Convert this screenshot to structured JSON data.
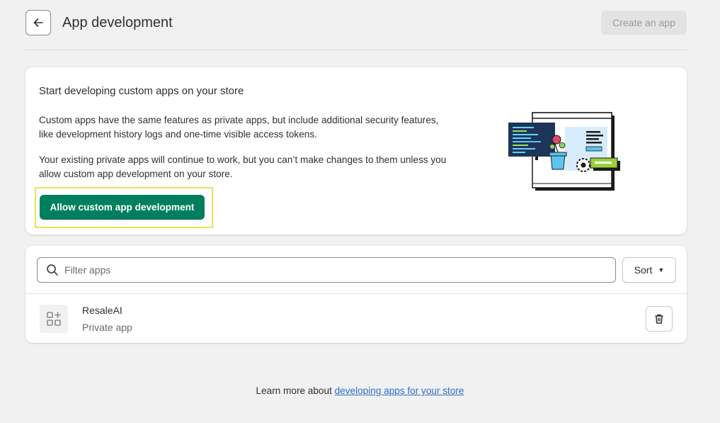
{
  "header": {
    "title": "App development",
    "create_button": "Create an app",
    "back_icon": "arrow-left-icon"
  },
  "intro": {
    "heading": "Start developing custom apps on your store",
    "paragraph1": "Custom apps have the same features as private apps, but include additional security features, like development history logs and one-time visible access tokens.",
    "paragraph2": "Your existing private apps will continue to work, but you can’t make changes to them unless you allow custom app development on your store.",
    "allow_button": "Allow custom app development",
    "highlight_color": "#e8e35a",
    "primary_color": "#007f5f"
  },
  "apps": {
    "filter_placeholder": "Filter apps",
    "sort_label": "Sort",
    "items": [
      {
        "name": "ResaleAI",
        "type": "Private app"
      }
    ]
  },
  "footer": {
    "text": "Learn more about ",
    "link": "developing apps for your store"
  }
}
